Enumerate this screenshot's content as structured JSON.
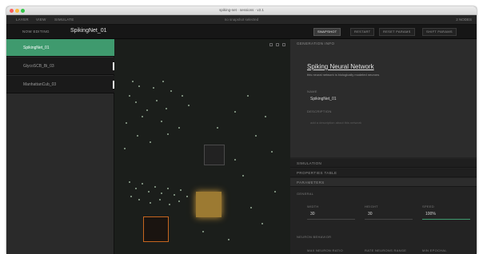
{
  "window": {
    "title": "spiking-net · sessions · v2.1"
  },
  "menu": {
    "items": [
      "LAYER",
      "VIEW",
      "SIMULATE"
    ],
    "center": "no snapshot selected",
    "right": "2 NODES"
  },
  "toolbar": {
    "mode": "NOW EDITING",
    "network": "SpikingNet_01",
    "buttons": [
      "SNAPSHOT",
      "RESTART",
      "RESET PARAMS",
      "SHIFT PARAMS"
    ]
  },
  "sidebar": {
    "items": [
      {
        "label": "SpikingNet_01",
        "active": true
      },
      {
        "label": "GlycoSCB_Bi_03",
        "active": false
      },
      {
        "label": "ManhattanCub_03",
        "active": false
      }
    ]
  },
  "panel": {
    "generation_title": "GENERATION INFO",
    "network_name": "Spiking Neural Network",
    "network_desc": "this neural network is biologically modeled neurons",
    "name_label": "NAME",
    "name_value": "SpikingNet_01",
    "desc_label": "DESCRIPTION",
    "desc_placeholder": "add a description about this network",
    "sections": [
      "SIMULATION",
      "PROPERTIES TABLE",
      "PARAMETERS"
    ],
    "general_label": "GENERAL",
    "general_fields": [
      {
        "label": "WIDTH",
        "value": "30"
      },
      {
        "label": "HEIGHT",
        "value": "30"
      },
      {
        "label": "SPEED",
        "value": "100%"
      }
    ],
    "neuron_label": "NEURON BEHAVIOR",
    "neuron_fields": [
      {
        "label": "MAX NEURON RATIO"
      },
      {
        "label": "RATE NEURONS RANGE"
      },
      {
        "label": "MIN EPOCHAL"
      }
    ]
  },
  "colors": {
    "accent": "#3f9a6e",
    "glow": "#c8963a",
    "node_orange": "#c5651f"
  }
}
